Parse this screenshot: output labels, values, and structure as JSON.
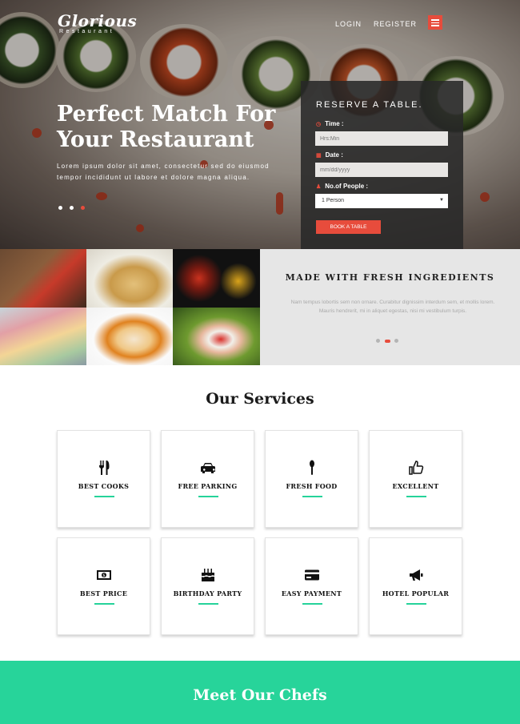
{
  "brand": {
    "name": "Glorious",
    "tagline": "Restaurant"
  },
  "nav": {
    "login": "LOGIN",
    "register": "REGISTER",
    "menu_icon": "hamburger-icon"
  },
  "hero": {
    "title": "Perfect Match For Your Restaurant",
    "text": "Lorem ipsum dolor sit amet, consectetur sed do eiusmod tempor incididunt ut labore et dolore magna aliqua."
  },
  "reserve": {
    "title": "RESERVE A TABLE.",
    "time_label": "Time :",
    "time_placeholder": "Hrs:Min",
    "date_label": "Date :",
    "date_placeholder": "mm/dd/yyyy",
    "people_label": "No.of People :",
    "people_selected": "1 Person",
    "submit": "BOOK A TABLE"
  },
  "fresh": {
    "title": "MADE WITH FRESH INGREDIENTS",
    "text": "Nam tempus lobortis sem non ornare. Curabitur dignissim interdum sem, et mollis lorem. Mauris hendrerit, mi in aliquet egestas, nisi mi vestibulum turpis."
  },
  "services": {
    "title": "Our Services",
    "items": [
      {
        "label": "BEST COOKS",
        "icon": "cutlery-icon"
      },
      {
        "label": "FREE PARKING",
        "icon": "car-icon"
      },
      {
        "label": "FRESH FOOD",
        "icon": "spoon-icon"
      },
      {
        "label": "EXCELLENT",
        "icon": "thumbs-up-icon"
      },
      {
        "label": "BEST PRICE",
        "icon": "money-icon"
      },
      {
        "label": "BIRTHDAY PARTY",
        "icon": "birthday-cake-icon"
      },
      {
        "label": "EASY PAYMENT",
        "icon": "credit-card-icon"
      },
      {
        "label": "HOTEL POPULAR",
        "icon": "bullhorn-icon"
      }
    ]
  },
  "chefs": {
    "title": "Meet Our Chefs"
  },
  "colors": {
    "accent_red": "#e74c3c",
    "accent_green": "#27d49a"
  }
}
